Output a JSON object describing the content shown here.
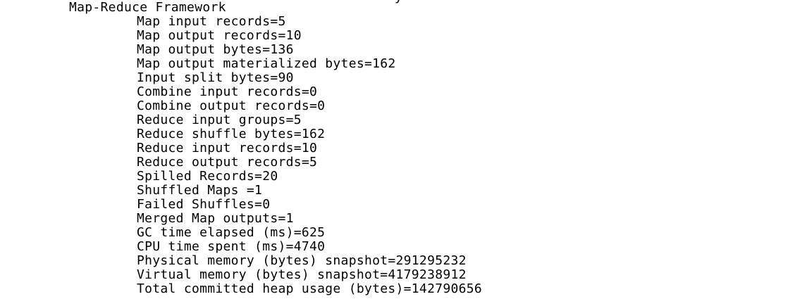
{
  "terminal": {
    "top_fragment": "y",
    "section_header": "Map-Reduce Framework",
    "counters": [
      "Map input records=5",
      "Map output records=10",
      "Map output bytes=136",
      "Map output materialized bytes=162",
      "Input split bytes=90",
      "Combine input records=0",
      "Combine output records=0",
      "Reduce input groups=5",
      "Reduce shuffle bytes=162",
      "Reduce input records=10",
      "Reduce output records=5",
      "Spilled Records=20",
      "Shuffled Maps =1",
      "Failed Shuffles=0",
      "Merged Map outputs=1",
      "GC time elapsed (ms)=625",
      "CPU time spent (ms)=4740",
      "Physical memory (bytes) snapshot=291295232",
      "Virtual memory (bytes) snapshot=4179238912",
      "Total committed heap usage (bytes)=142790656"
    ],
    "bottom_fragment": "  ---"
  }
}
